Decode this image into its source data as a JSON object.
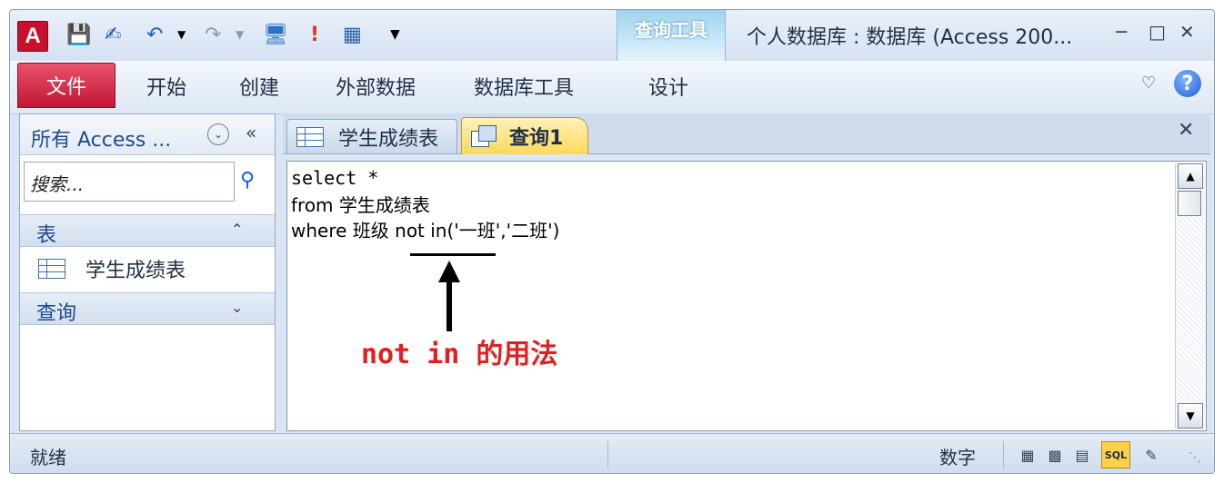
{
  "app": {
    "logo": "A",
    "title": "个人数据库 : 数据库 (Access 200..."
  },
  "quick_access": {
    "icons": [
      "save-icon",
      "design-icon",
      "undo-icon",
      "redo-icon",
      "view-icon",
      "run-icon",
      "table-icon",
      "customize-icon"
    ]
  },
  "ribbon": {
    "file_tab": "文件",
    "tabs": [
      "开始",
      "创建",
      "外部数据",
      "数据库工具"
    ],
    "context_group": "查询工具",
    "context_tab": "设计"
  },
  "nav": {
    "header": "所有 Access ...",
    "search_placeholder": "搜索...",
    "groups": [
      {
        "label": "表",
        "items": [
          "学生成绩表"
        ]
      },
      {
        "label": "查询",
        "items": []
      }
    ]
  },
  "doc_tabs": [
    {
      "label": "学生成绩表",
      "active": false
    },
    {
      "label": "查询1",
      "active": true
    }
  ],
  "editor": {
    "lines": [
      "select *",
      "from 学生成绩表",
      "where 班级 not in('一班','二班')"
    ]
  },
  "annotation": {
    "text": "not in 的用法",
    "color": "#e02020"
  },
  "status": {
    "left": "就绪",
    "mode": "数字",
    "sql_button": "SQL"
  },
  "colors": {
    "file_tab": "#c11634",
    "context_tab": "#9fd4ee",
    "active_doc_tab": "#ffd95a"
  }
}
